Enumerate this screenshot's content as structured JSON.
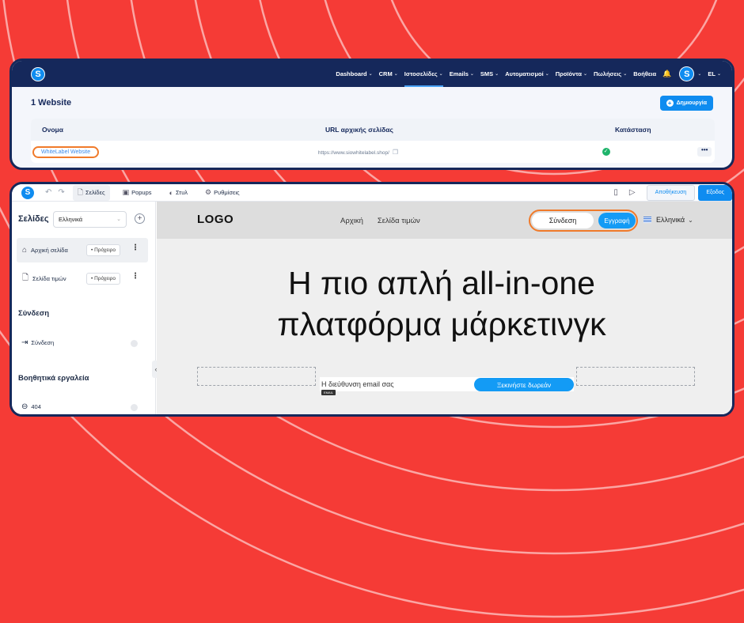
{
  "top_panel": {
    "nav": {
      "logo": "S",
      "items": [
        {
          "label": "Dashboard"
        },
        {
          "label": "CRM"
        },
        {
          "label": "Ιστοσελίδες"
        },
        {
          "label": "Emails"
        },
        {
          "label": "SMS"
        },
        {
          "label": "Αυτοματισμοί"
        },
        {
          "label": "Προϊόντα"
        },
        {
          "label": "Πωλήσεις"
        },
        {
          "label": "Βοήθεια"
        }
      ],
      "avatar": "S",
      "language": "EL"
    },
    "title": "1 Website",
    "create_button": "Δημιουργία",
    "table": {
      "headers": [
        "Ονομα",
        "URL αρχικής σελίδας",
        "Κατάσταση"
      ],
      "rows": [
        {
          "name": "WhiteLabel Website",
          "url": "https://www.siowhitelabel.shop/",
          "more": "•••"
        }
      ]
    }
  },
  "editor": {
    "toolbar": {
      "logo": "S",
      "tabs": [
        {
          "label": "Σελίδες"
        },
        {
          "label": "Popups"
        },
        {
          "label": "Στυλ"
        },
        {
          "label": "Ρυθμίσεις"
        }
      ],
      "save_label": "Αποθήκευση",
      "exit_label": "Εξοδος"
    },
    "sidebar": {
      "heading": "Σελίδες",
      "language": "Ελληνικά",
      "pages": [
        {
          "label": "Αρχική σελίδα",
          "status": "• Πρόχειρο"
        },
        {
          "label": "Σελίδα τιμών",
          "status": "• Πρόχειρο"
        }
      ],
      "section_login": "Σύνδεση",
      "login_item": "Σύνδεση",
      "section_tools": "Βοηθητικά εργαλεία",
      "tools_item": "404"
    },
    "canvas": {
      "logo": "LOGO",
      "menu": [
        "Αρχική",
        "Σελίδα τιμών"
      ],
      "login_button": "Σύνδεση",
      "signup_button": "Εγγραφή",
      "language": "Ελληνικά",
      "hero_line1": "Η πιο απλή all-in-one",
      "hero_line2": "πλατφόρμα μάρκετινγκ",
      "email_placeholder": "Η διεύθυνση email σας",
      "email_tag": "EMAIL",
      "cta_button": "Ξεκινήστε δωρεάν"
    }
  },
  "colors": {
    "background": "#f53b36",
    "nav": "#15285b",
    "accent": "#0f8cf0",
    "highlight": "#f07a2a"
  }
}
